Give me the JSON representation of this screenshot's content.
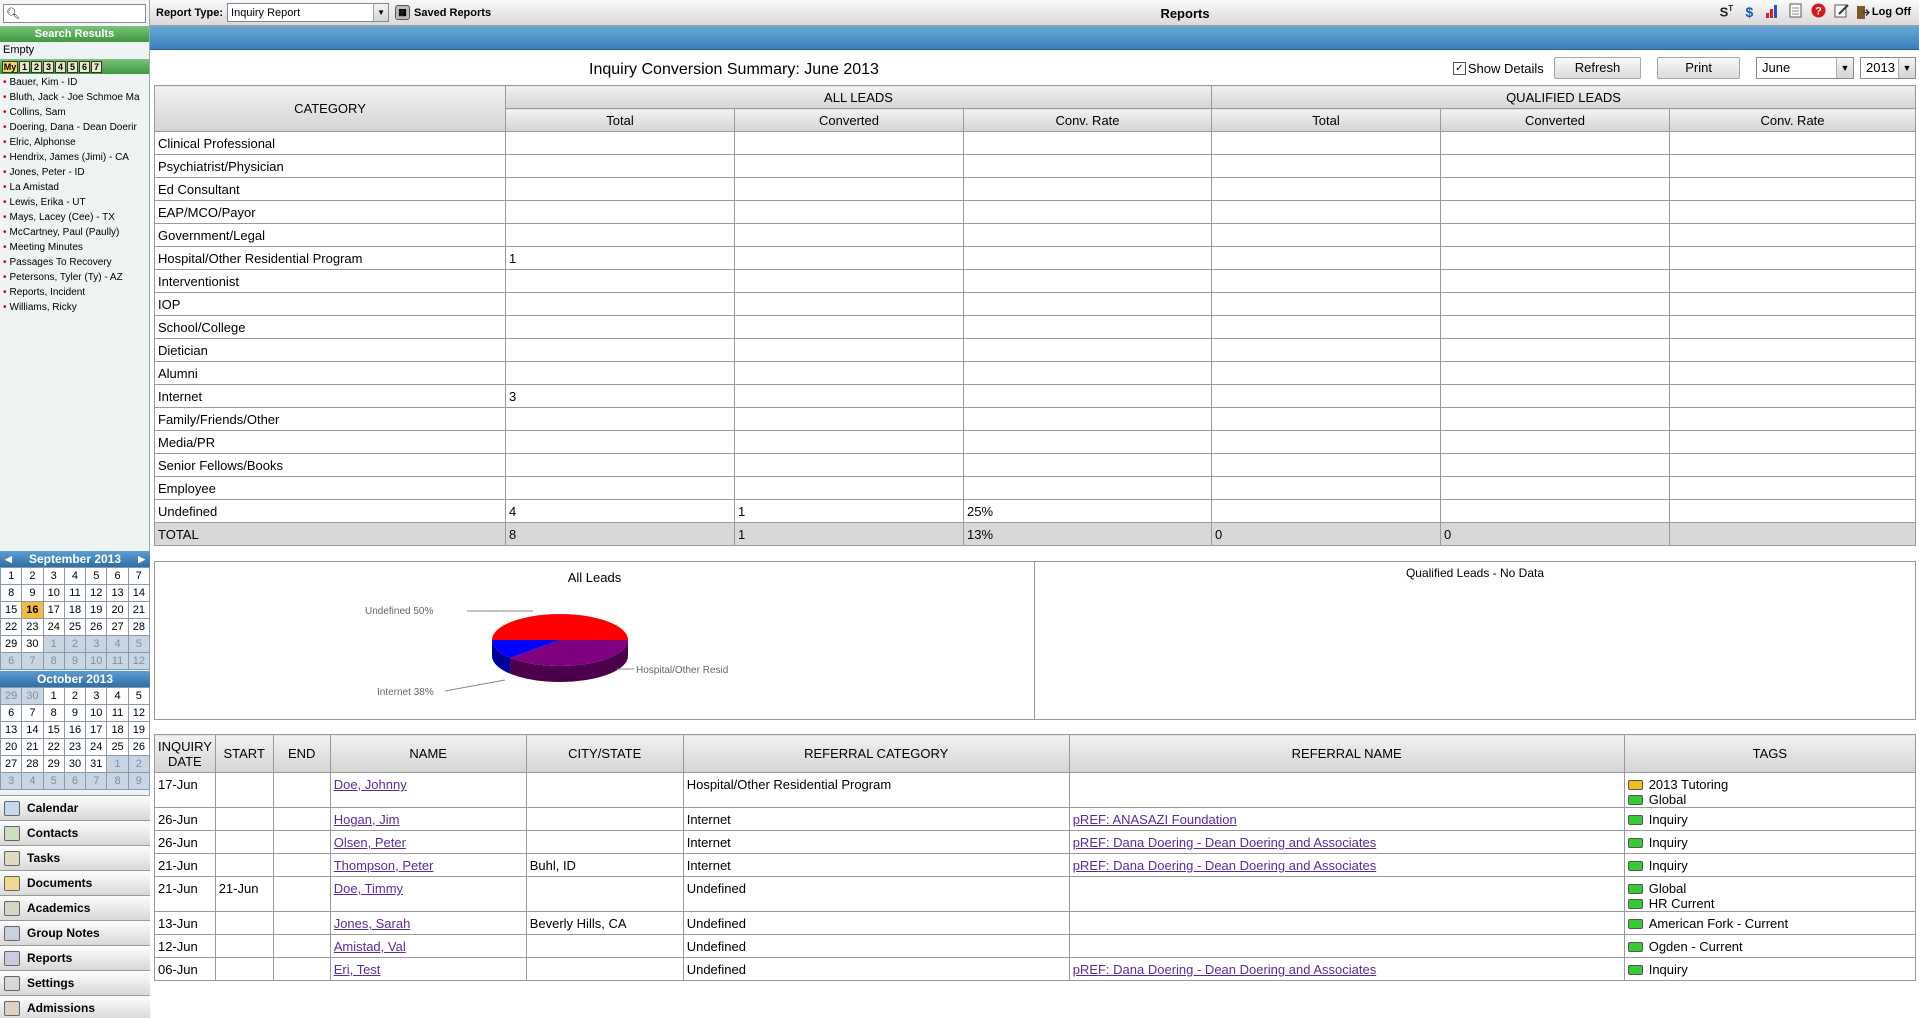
{
  "header": {
    "report_type_label": "Report Type:",
    "report_type_value": "Inquiry Report",
    "saved_reports_label": "Saved Reports",
    "page_title": "Reports",
    "log_off_label": "Log Off",
    "icons": [
      "st-icon",
      "dollar-icon",
      "bar-chart-icon",
      "document-icon",
      "help-icon",
      "edit-icon",
      "log-off-icon"
    ]
  },
  "sidebar": {
    "search_placeholder": "",
    "results_label": "Search Results",
    "empty_text": "Empty",
    "tabs": [
      "My",
      "1",
      "2",
      "3",
      "4",
      "5",
      "6",
      "7"
    ],
    "contacts": [
      "Bauer, Kim - ID",
      "Bluth, Jack - Joe Schmoe Ma",
      "Collins, Sam",
      "Doering, Dana - Dean Doerir",
      "Elric, Alphonse",
      "Hendrix, James (Jimi) - CA",
      "Jones, Peter - ID",
      "La Amistad",
      "Lewis, Erika - UT",
      "Mays, Lacey (Cee) - TX",
      "McCartney, Paul (Paully)",
      "Meeting Minutes",
      "Passages To Recovery",
      "Petersons, Tyler (Ty) - AZ",
      "Reports, Incident",
      "Williams, Ricky"
    ],
    "cal1": {
      "title": "September 2013",
      "prev": "◀",
      "next": "▶",
      "today": "16",
      "days": [
        "1",
        "2",
        "3",
        "4",
        "5",
        "6",
        "7",
        "8",
        "9",
        "10",
        "11",
        "12",
        "13",
        "14",
        "15",
        "16",
        "17",
        "18",
        "19",
        "20",
        "21",
        "22",
        "23",
        "24",
        "25",
        "26",
        "27",
        "28",
        "29",
        "30",
        "1",
        "2",
        "3",
        "4",
        "5",
        "6",
        "7",
        "8",
        "9",
        "10",
        "11",
        "12"
      ]
    },
    "cal2": {
      "title": "October 2013",
      "days": [
        "29",
        "30",
        "1",
        "2",
        "3",
        "4",
        "5",
        "6",
        "7",
        "8",
        "9",
        "10",
        "11",
        "12",
        "13",
        "14",
        "15",
        "16",
        "17",
        "18",
        "19",
        "20",
        "21",
        "22",
        "23",
        "24",
        "25",
        "26",
        "27",
        "28",
        "29",
        "30",
        "31",
        "1",
        "2",
        "3",
        "4",
        "5",
        "6",
        "7",
        "8",
        "9"
      ]
    },
    "nav": [
      "Calendar",
      "Contacts",
      "Tasks",
      "Documents",
      "Academics",
      "Group Notes",
      "Reports",
      "Settings",
      "Admissions"
    ]
  },
  "report": {
    "title": "Inquiry Conversion Summary: June 2013",
    "show_details_label": "Show Details",
    "show_details_checked": true,
    "refresh_label": "Refresh",
    "print_label": "Print",
    "month": "June",
    "year": "2013",
    "summary": {
      "category_header": "CATEGORY",
      "all_leads_header": "ALL LEADS",
      "qualified_leads_header": "QUALIFIED LEADS",
      "sub_headers": [
        "Total",
        "Converted",
        "Conv. Rate",
        "Total",
        "Converted",
        "Conv. Rate"
      ],
      "rows": [
        [
          "Clinical Professional",
          "",
          "",
          "",
          "",
          "",
          ""
        ],
        [
          "Psychiatrist/Physician",
          "",
          "",
          "",
          "",
          "",
          ""
        ],
        [
          "Ed Consultant",
          "",
          "",
          "",
          "",
          "",
          ""
        ],
        [
          "EAP/MCO/Payor",
          "",
          "",
          "",
          "",
          "",
          ""
        ],
        [
          "Government/Legal",
          "",
          "",
          "",
          "",
          "",
          ""
        ],
        [
          "Hospital/Other Residential Program",
          "1",
          "",
          "",
          "",
          "",
          ""
        ],
        [
          "Interventionist",
          "",
          "",
          "",
          "",
          "",
          ""
        ],
        [
          "IOP",
          "",
          "",
          "",
          "",
          "",
          ""
        ],
        [
          "School/College",
          "",
          "",
          "",
          "",
          "",
          ""
        ],
        [
          "Dietician",
          "",
          "",
          "",
          "",
          "",
          ""
        ],
        [
          "Alumni",
          "",
          "",
          "",
          "",
          "",
          ""
        ],
        [
          "Internet",
          "3",
          "",
          "",
          "",
          "",
          ""
        ],
        [
          "Family/Friends/Other",
          "",
          "",
          "",
          "",
          "",
          ""
        ],
        [
          "Media/PR",
          "",
          "",
          "",
          "",
          "",
          ""
        ],
        [
          "Senior Fellows/Books",
          "",
          "",
          "",
          "",
          "",
          ""
        ],
        [
          "Employee",
          "",
          "",
          "",
          "",
          "",
          ""
        ],
        [
          "Undefined",
          "4",
          "1",
          "25%",
          "",
          "",
          ""
        ]
      ],
      "total": [
        "TOTAL",
        "8",
        "1",
        "13%",
        "0",
        "0",
        ""
      ]
    },
    "charts": {
      "all_leads_title": "All Leads",
      "qualified_title": "Qualified Leads - No Data",
      "pie_labels": {
        "undefined": "Undefined 50%",
        "internet": "Internet 38%",
        "hospital": "Hospital/Other Resid"
      },
      "colors": {
        "undefined": "#ff0000",
        "internet": "#800080",
        "hospital": "#0000ff"
      }
    },
    "details": {
      "headers": [
        "INQUIRY DATE",
        "START",
        "END",
        "NAME",
        "CITY/STATE",
        "REFERRAL CATEGORY",
        "REFERRAL NAME",
        "TAGS"
      ],
      "rows": [
        {
          "date": "17-Jun",
          "start": "",
          "end": "",
          "name": "Doe, Johnny",
          "city": "",
          "ref_cat": "Hospital/Other Residential Program",
          "ref_name": "",
          "tags": [
            {
              "label": "2013 Tutoring",
              "color": "yellow"
            },
            {
              "label": "Global",
              "color": "green"
            }
          ]
        },
        {
          "date": "26-Jun",
          "start": "",
          "end": "",
          "name": "Hogan, Jim",
          "city": "",
          "ref_cat": "Internet",
          "ref_name": "pREF: ANASAZI Foundation",
          "tags": [
            {
              "label": "Inquiry",
              "color": "green"
            }
          ]
        },
        {
          "date": "26-Jun",
          "start": "",
          "end": "",
          "name": "Olsen, Peter",
          "city": "",
          "ref_cat": "Internet",
          "ref_name": "pREF: Dana Doering - Dean Doering and Associates",
          "tags": [
            {
              "label": "Inquiry",
              "color": "green"
            }
          ]
        },
        {
          "date": "21-Jun",
          "start": "",
          "end": "",
          "name": "Thompson, Peter",
          "city": "Buhl, ID",
          "ref_cat": "Internet",
          "ref_name": "pREF: Dana Doering - Dean Doering and Associates",
          "tags": [
            {
              "label": "Inquiry",
              "color": "green"
            }
          ]
        },
        {
          "date": "21-Jun",
          "start": "21-Jun",
          "end": "",
          "name": "Doe, Timmy",
          "city": "",
          "ref_cat": "Undefined",
          "ref_name": "",
          "tags": [
            {
              "label": "Global",
              "color": "green"
            },
            {
              "label": "HR Current",
              "color": "green"
            }
          ]
        },
        {
          "date": "13-Jun",
          "start": "",
          "end": "",
          "name": "Jones, Sarah",
          "city": "Beverly Hills, CA",
          "ref_cat": "Undefined",
          "ref_name": "",
          "tags": [
            {
              "label": "American Fork - Current",
              "color": "green"
            }
          ]
        },
        {
          "date": "12-Jun",
          "start": "",
          "end": "",
          "name": "Amistad, Val",
          "city": "",
          "ref_cat": "Undefined",
          "ref_name": "",
          "tags": [
            {
              "label": "Ogden - Current",
              "color": "green"
            }
          ]
        },
        {
          "date": "06-Jun",
          "start": "",
          "end": "",
          "name": "Eri, Test",
          "city": "",
          "ref_cat": "Undefined",
          "ref_name": "pREF: Dana Doering - Dean Doering and Associates",
          "tags": [
            {
              "label": "Inquiry",
              "color": "green"
            }
          ]
        }
      ]
    }
  },
  "chart_data": {
    "type": "pie",
    "title": "All Leads",
    "labels": [
      "Undefined",
      "Internet",
      "Hospital/Other Resid"
    ],
    "values": [
      50,
      38,
      12
    ]
  }
}
